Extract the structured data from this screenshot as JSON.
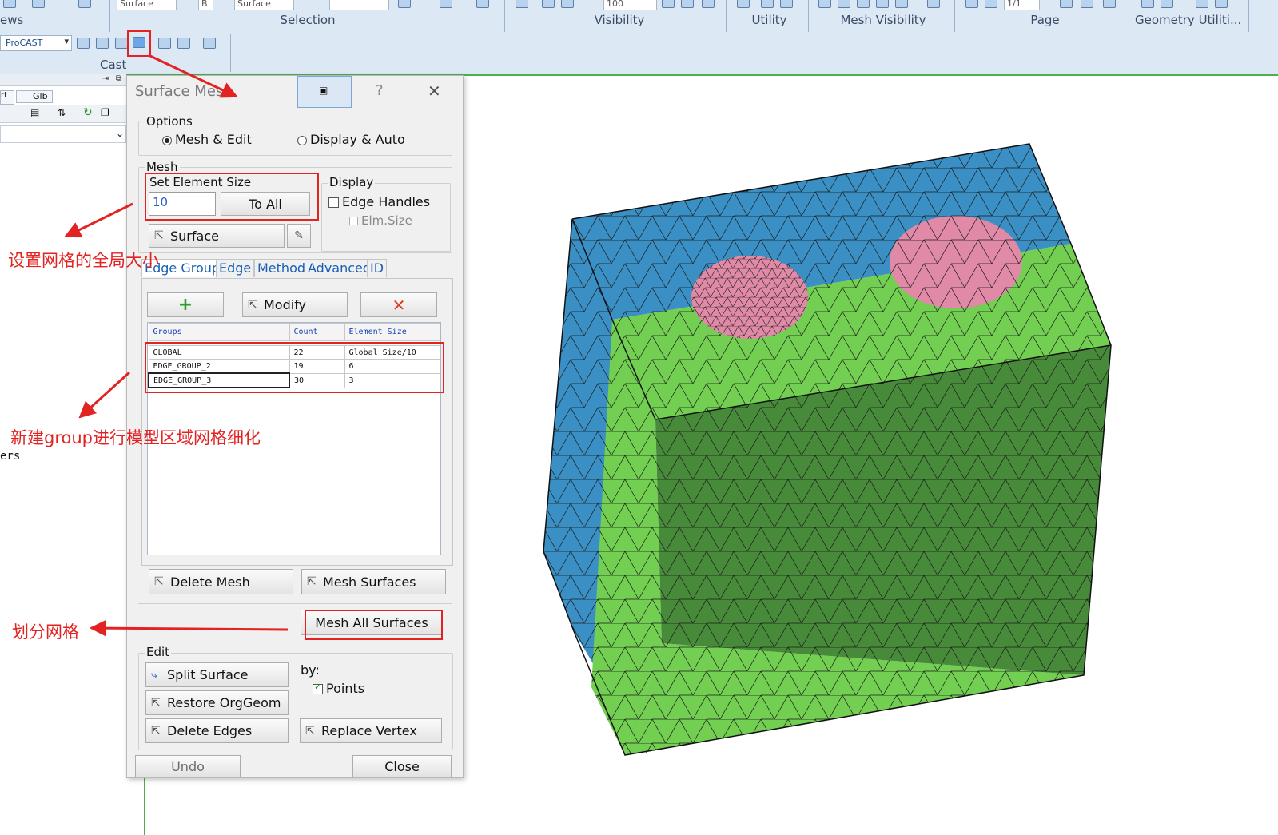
{
  "ribbon": {
    "groups": [
      "ews",
      "Selection",
      "Visibility",
      "Utility",
      "Mesh Visibility",
      "Page",
      "Geometry Utiliti..."
    ],
    "cast_label": "Cast",
    "procast_value": "ProCAST",
    "surface_edge_1": "Surface Edge",
    "surface_edge_2": "Surface Edge",
    "b_field": "B",
    "zoom_value": "100",
    "page_value": "1/1"
  },
  "leftpanel": {
    "tab_rt": "rt",
    "tab_glb": "Glb",
    "fragment_ers": "ers"
  },
  "dialog": {
    "title": "Surface Mesh",
    "help": "?",
    "close": "✕",
    "options": {
      "label": "Options",
      "mesh_edit": "Mesh & Edit",
      "display_auto": "Display & Auto"
    },
    "mesh": {
      "label": "Mesh",
      "set_element_size_label": "Set Element Size",
      "element_size_value": "10",
      "to_all": "To All",
      "surface": "Surface"
    },
    "display": {
      "label": "Display",
      "edge_handles": "Edge Handles",
      "elm_size": "Elm.Size"
    },
    "tabs": [
      "Edge Group",
      "Edge",
      "Method",
      "Advanced",
      "ID"
    ],
    "edge_group": {
      "modify": "Modify",
      "columns": [
        "Groups",
        "Count",
        "Element Size"
      ],
      "rows": [
        [
          "GLOBAL",
          "22",
          "Global Size/10"
        ],
        [
          "EDGE_GROUP_2",
          "19",
          "6"
        ],
        [
          "EDGE_GROUP_3",
          "30",
          "3"
        ]
      ]
    },
    "delete_mesh": "Delete Mesh",
    "mesh_surfaces": "Mesh Surfaces",
    "mesh_all_surfaces": "Mesh All Surfaces",
    "edit": {
      "label": "Edit",
      "split_surface": "Split Surface",
      "restore_orggeom": "Restore OrgGeom",
      "delete_edges": "Delete Edges",
      "by_label": "by:",
      "points": "Points",
      "replace_vertex": "Replace Vertex"
    },
    "undo": "Undo",
    "close_btn": "Close"
  },
  "annotations": {
    "global_size": "设置网格的全局大小",
    "new_group": "新建group进行模型区域网格细化",
    "mesh_it": "划分网格"
  },
  "colors": {
    "accent_red": "#e32222",
    "face_blue": "#3a8fc4",
    "face_light_green": "#72cf52",
    "face_dark_green": "#478a3a",
    "face_pink": "#e08aa8"
  }
}
